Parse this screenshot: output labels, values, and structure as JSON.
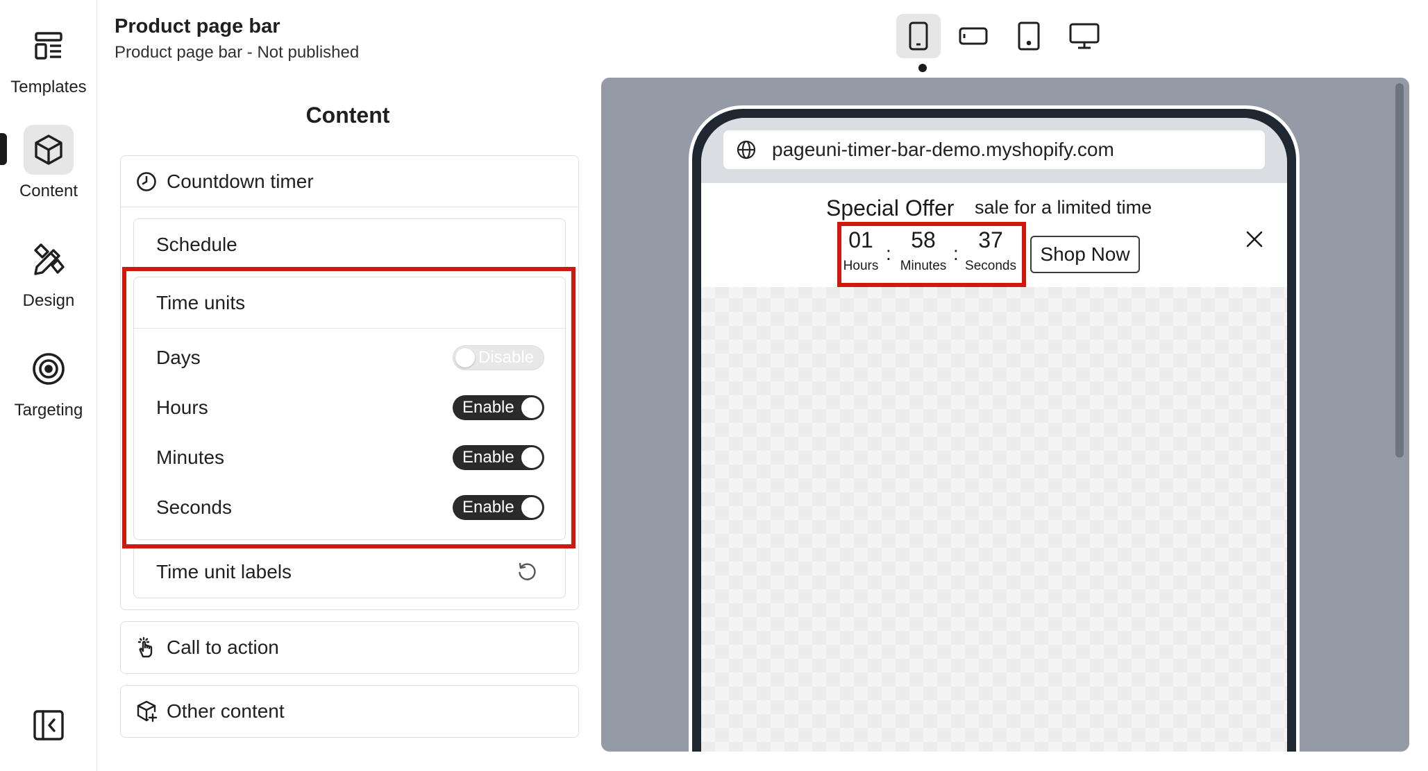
{
  "rail": {
    "templates_label": "Templates",
    "content_label": "Content",
    "design_label": "Design",
    "targeting_label": "Targeting"
  },
  "header": {
    "title": "Product page bar",
    "subtitle": "Product page bar - Not published"
  },
  "panel": {
    "heading": "Content",
    "countdown_label": "Countdown timer",
    "schedule_label": "Schedule",
    "time_units": {
      "title": "Time units",
      "rows": [
        {
          "label": "Days",
          "state": "Disable"
        },
        {
          "label": "Hours",
          "state": "Enable"
        },
        {
          "label": "Minutes",
          "state": "Enable"
        },
        {
          "label": "Seconds",
          "state": "Enable"
        }
      ]
    },
    "time_unit_labels": "Time unit labels",
    "call_to_action": "Call to action",
    "other_content": "Other content"
  },
  "devices": [
    "mobile",
    "mobile-landscape",
    "tablet",
    "desktop"
  ],
  "preview": {
    "url": "pageuni-timer-bar-demo.myshopify.com",
    "offer_title": "Special Offer",
    "offer_sub": "sale for a limited time",
    "timer": [
      {
        "value": "01",
        "label": "Hours"
      },
      {
        "value": "58",
        "label": "Minutes"
      },
      {
        "value": "37",
        "label": "Seconds"
      }
    ],
    "separator": ":",
    "cta": "Shop Now"
  },
  "colors": {
    "highlight": "#d0180f",
    "toggle_on": "#2a2a2a",
    "preview_bg": "#949aa6",
    "phone_frame": "#1f2731"
  }
}
